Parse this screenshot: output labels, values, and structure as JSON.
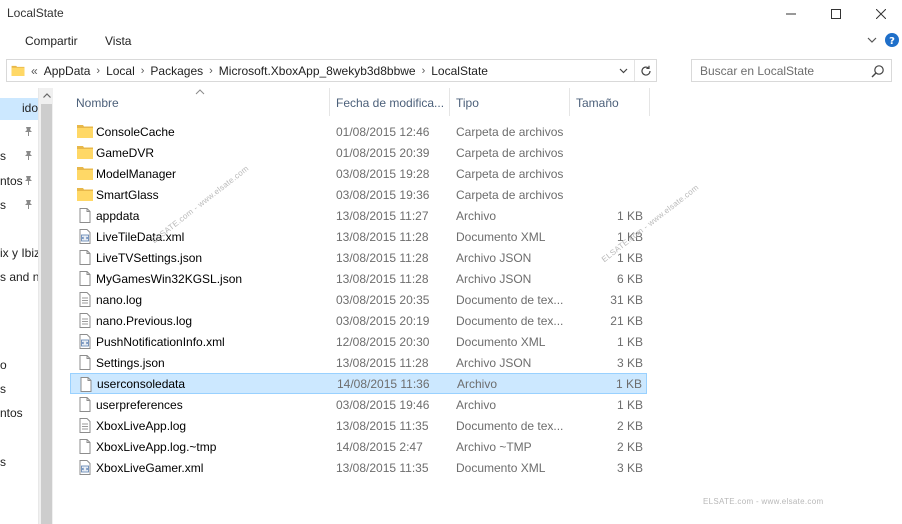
{
  "window": {
    "title": "LocalState",
    "controls": [
      "minimize-icon",
      "maximize-icon",
      "close-icon"
    ]
  },
  "ribbon": {
    "tabs": [
      {
        "label": "Compartir"
      },
      {
        "label": "Vista"
      }
    ]
  },
  "address": {
    "overflow": "«",
    "crumbs": [
      "AppData",
      "Local",
      "Packages",
      "Microsoft.XboxApp_8wekyb3d8bbwe",
      "LocalState"
    ],
    "separator": "›"
  },
  "search": {
    "placeholder": "Buscar en LocalState"
  },
  "nav_pane": {
    "items": [
      {
        "label": "ido",
        "selected": true
      },
      {
        "label": "s",
        "pinned": true
      },
      {
        "label": "s",
        "pinned": true
      },
      {
        "label": "ntos",
        "pinned": true
      },
      {
        "label": "s",
        "pinned": true
      },
      {
        "label": "ix y Ibiz"
      },
      {
        "label": "s and n"
      },
      {
        "label": "o"
      },
      {
        "label": "s"
      },
      {
        "label": "ntos"
      },
      {
        "label": "s"
      }
    ]
  },
  "columns": {
    "name": "Nombre",
    "date": "Fecha de modifica...",
    "type": "Tipo",
    "size": "Tamaño"
  },
  "files": [
    {
      "name": "ConsoleCache",
      "date": "01/08/2015 12:46",
      "type": "Carpeta de archivos",
      "size": "",
      "icon": "folder-icon"
    },
    {
      "name": "GameDVR",
      "date": "01/08/2015 20:39",
      "type": "Carpeta de archivos",
      "size": "",
      "icon": "folder-icon"
    },
    {
      "name": "ModelManager",
      "date": "03/08/2015 19:28",
      "type": "Carpeta de archivos",
      "size": "",
      "icon": "folder-icon"
    },
    {
      "name": "SmartGlass",
      "date": "03/08/2015 19:36",
      "type": "Carpeta de archivos",
      "size": "",
      "icon": "folder-icon"
    },
    {
      "name": "appdata",
      "date": "13/08/2015 11:27",
      "type": "Archivo",
      "size": "1 KB",
      "icon": "file-icon"
    },
    {
      "name": "LiveTileData.xml",
      "date": "13/08/2015 11:28",
      "type": "Documento XML",
      "size": "1 KB",
      "icon": "xml-file-icon"
    },
    {
      "name": "LiveTVSettings.json",
      "date": "13/08/2015 11:28",
      "type": "Archivo JSON",
      "size": "1 KB",
      "icon": "file-icon"
    },
    {
      "name": "MyGamesWin32KGSL.json",
      "date": "13/08/2015 11:28",
      "type": "Archivo JSON",
      "size": "6 KB",
      "icon": "file-icon"
    },
    {
      "name": "nano.log",
      "date": "03/08/2015 20:35",
      "type": "Documento de tex...",
      "size": "31 KB",
      "icon": "text-file-icon"
    },
    {
      "name": "nano.Previous.log",
      "date": "03/08/2015 20:19",
      "type": "Documento de tex...",
      "size": "21 KB",
      "icon": "text-file-icon"
    },
    {
      "name": "PushNotificationInfo.xml",
      "date": "12/08/2015 20:30",
      "type": "Documento XML",
      "size": "1 KB",
      "icon": "xml-file-icon"
    },
    {
      "name": "Settings.json",
      "date": "13/08/2015 11:28",
      "type": "Archivo JSON",
      "size": "3 KB",
      "icon": "file-icon"
    },
    {
      "name": "userconsoledata",
      "date": "14/08/2015 11:36",
      "type": "Archivo",
      "size": "1 KB",
      "icon": "file-icon",
      "selected": true
    },
    {
      "name": "userpreferences",
      "date": "03/08/2015 19:46",
      "type": "Archivo",
      "size": "1 KB",
      "icon": "file-icon"
    },
    {
      "name": "XboxLiveApp.log",
      "date": "13/08/2015 11:35",
      "type": "Documento de tex...",
      "size": "2 KB",
      "icon": "text-file-icon"
    },
    {
      "name": "XboxLiveApp.log.~tmp",
      "date": "14/08/2015 2:47",
      "type": "Archivo ~TMP",
      "size": "2 KB",
      "icon": "file-icon"
    },
    {
      "name": "XboxLiveGamer.xml",
      "date": "13/08/2015 11:35",
      "type": "Documento XML",
      "size": "3 KB",
      "icon": "xml-file-icon"
    }
  ],
  "watermarks": {
    "diag1": "ELSATE.com - www.elsate.com",
    "diag2": "ELSATE.com - www.elsate.com",
    "bottom": "ELSATE.com - www.elsate.com"
  },
  "colors": {
    "selection_bg": "#cce8ff",
    "selection_border": "#99d1ff",
    "folder_yellow": "#ffd866",
    "header_text": "#4c607a"
  }
}
